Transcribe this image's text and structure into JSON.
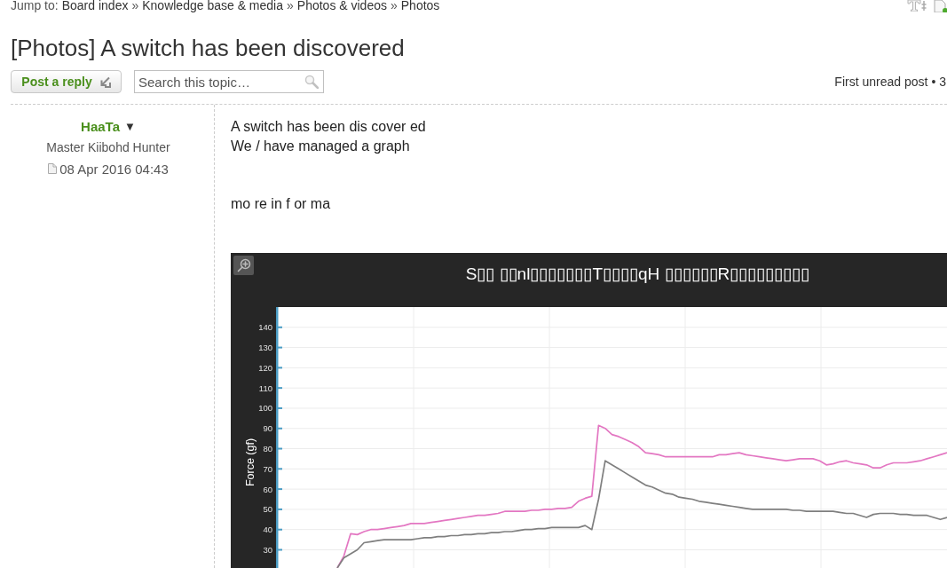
{
  "breadcrumbs": {
    "label": "Jump to:",
    "separator": "»",
    "links": [
      "Board index",
      "Knowledge base & media",
      "Photos & videos",
      "Photos"
    ]
  },
  "topic": {
    "title": "[Photos] A switch has been discovered"
  },
  "actions": {
    "reply_button": "Post a reply",
    "search": {
      "placeholder": "Search this topic…"
    },
    "first_unread_link": "First unread post",
    "post_count": "• 3"
  },
  "post": {
    "author": {
      "name": "HaaTa",
      "caret": "▼",
      "rank": "Master Kiibohd Hunter"
    },
    "date": "08 Apr 2016 04:43",
    "body_lines": [
      "A switch has been dis cover ed",
      "We / have managed a graph",
      "mo re in f or ma"
    ],
    "chart": {
      "title": "S▯▯ ▯▯nl▯▯▯▯▯▯▯T▯▯▯▯qH ▯▯▯▯▯▯R▯▯▯▯▯▯▯▯▯",
      "chart_data": {
        "type": "line",
        "ylabel": "Force (gf)",
        "grid": true,
        "categories": [
          null,
          null,
          null,
          null,
          null,
          null,
          null,
          null,
          null,
          null,
          null,
          null,
          null,
          null,
          null,
          null,
          null,
          null,
          null,
          null,
          null,
          null,
          null,
          null,
          null,
          null,
          null,
          null,
          null,
          null,
          null,
          null,
          null,
          null,
          null,
          null,
          null,
          null,
          null,
          null,
          null,
          null,
          null,
          null,
          null,
          null,
          null,
          null,
          null,
          null,
          null,
          null,
          null,
          null,
          null,
          null,
          null,
          null,
          null,
          null,
          null,
          null,
          null,
          null,
          null,
          null,
          null,
          null,
          null,
          null,
          null,
          null,
          null,
          null,
          null,
          null,
          null,
          null,
          null,
          null,
          null,
          null,
          null,
          null,
          null,
          null,
          null,
          null,
          null,
          null,
          null,
          null,
          null,
          null,
          null,
          null,
          null,
          null,
          null,
          null,
          null
        ],
        "ylim": [
          21,
          150
        ],
        "yticks": [
          30,
          40,
          50,
          60,
          70,
          80,
          90,
          100,
          110,
          120,
          130,
          140
        ],
        "series": [
          {
            "color": "#e377c2",
            "values": [
              null,
              null,
              null,
              null,
              null,
              null,
              null,
              null,
              null,
              21,
              27,
              38,
              37.5,
              39,
              40,
              40,
              40.5,
              41,
              41.5,
              42,
              43,
              43,
              43,
              43.5,
              44,
              44.5,
              45,
              45.5,
              46,
              46.5,
              47,
              47,
              47.5,
              48,
              49,
              49,
              49,
              49,
              49.5,
              49.5,
              50,
              50,
              50.5,
              50.5,
              51,
              54,
              55.5,
              56.5,
              91.5,
              90,
              87,
              86,
              84.5,
              83,
              81,
              78,
              77.5,
              77,
              76,
              76,
              76,
              76,
              76,
              76,
              76,
              76,
              77,
              77,
              77.5,
              78,
              77,
              76.5,
              76,
              75.5,
              75,
              74.5,
              74,
              74.5,
              75,
              75,
              75,
              74,
              72,
              72.5,
              73.5,
              74,
              73,
              72.5,
              72,
              70.5,
              70.5,
              72,
              73,
              73,
              73,
              73.5,
              74,
              75,
              76,
              77,
              78
            ]
          },
          {
            "color": "#7f7f7f",
            "values": [
              null,
              null,
              null,
              null,
              null,
              null,
              null,
              null,
              null,
              21,
              26,
              28,
              30,
              33.5,
              34,
              34.5,
              35,
              35,
              35,
              35,
              35,
              35.5,
              36,
              36,
              36.5,
              36.5,
              37,
              37,
              37.5,
              37.5,
              38,
              38,
              38.5,
              38.5,
              39,
              39,
              39.5,
              40,
              40,
              40.5,
              40.5,
              41,
              41,
              41,
              41,
              41,
              42,
              40,
              55,
              74,
              72,
              70,
              68,
              66,
              64,
              62,
              61,
              59.5,
              58,
              57.5,
              56,
              55.5,
              55,
              54,
              53.5,
              53,
              52.5,
              52,
              51.5,
              51,
              50.5,
              50,
              50,
              50,
              50,
              50,
              50,
              49.5,
              49.5,
              49,
              49,
              49,
              49,
              49,
              48.5,
              48,
              48,
              47,
              46,
              47.5,
              48,
              48,
              48,
              47.5,
              47.5,
              47,
              47,
              47,
              46,
              45,
              46
            ]
          }
        ]
      }
    }
  }
}
